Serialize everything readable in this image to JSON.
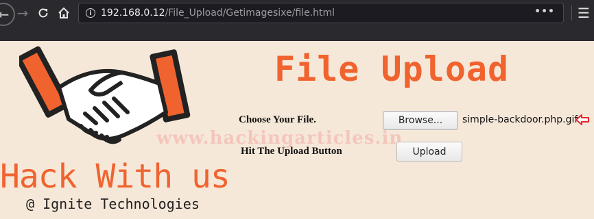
{
  "browser": {
    "url_host": "192.168.0.12",
    "url_path": "/File_Upload/Getimagesixe/file.html",
    "more_label": "•••",
    "icons": [
      "back-icon",
      "forward-icon",
      "reload-icon",
      "home-icon",
      "info-icon",
      "page-actions-icon",
      "menu-icon"
    ]
  },
  "brand": {
    "title": "Hack With us",
    "subtitle": "@ Ignite Technologies",
    "logo_icon": "handshake-icon",
    "accent_color": "#f0632f"
  },
  "page": {
    "title": "File Upload",
    "watermark": "www.hackingarticles.in",
    "choose_label": "Choose Your File.",
    "browse_label": "Browse...",
    "selected_file": "simple-backdoor.php.gif",
    "upload_label": "Hit The Upload Button",
    "upload_button": "Upload",
    "pointer_icon": "red-arrow-left-icon",
    "background_color": "#f6e8d9"
  }
}
